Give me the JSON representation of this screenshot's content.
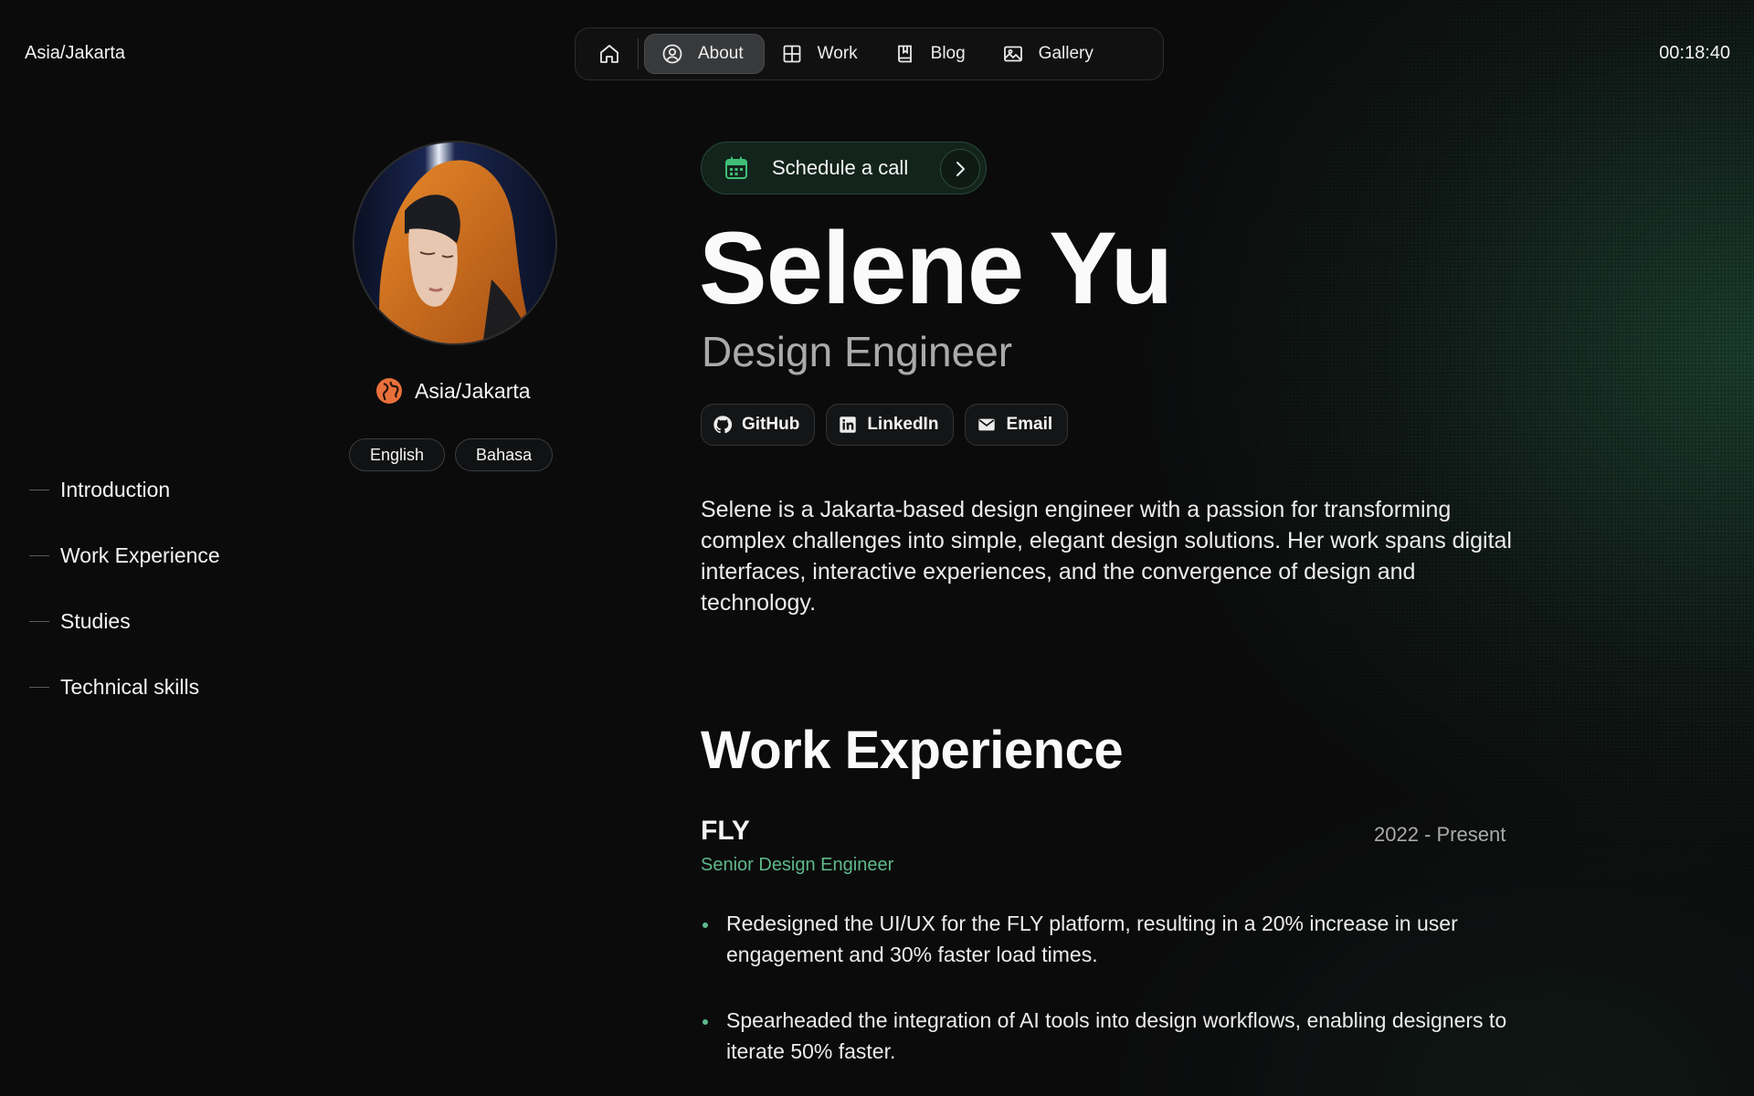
{
  "header": {
    "timezone": "Asia/Jakarta",
    "clock": "00:18:40"
  },
  "nav": {
    "items": [
      {
        "label": "About",
        "icon": "user-circle-icon",
        "active": true
      },
      {
        "label": "Work",
        "icon": "grid-icon"
      },
      {
        "label": "Blog",
        "icon": "book-icon"
      },
      {
        "label": "Gallery",
        "icon": "image-icon"
      }
    ]
  },
  "toc": [
    "Introduction",
    "Work Experience",
    "Studies",
    "Technical skills"
  ],
  "profile": {
    "location": "Asia/Jakarta",
    "languages": [
      "English",
      "Bahasa"
    ]
  },
  "hero": {
    "cta": "Schedule a call",
    "name": "Selene Yu",
    "role": "Design Engineer",
    "socials": [
      "GitHub",
      "LinkedIn",
      "Email"
    ],
    "intro": "Selene is a Jakarta-based design engineer with a passion for transforming complex challenges into simple, elegant design solutions. Her work spans digital interfaces, interactive experiences, and the convergence of design and technology."
  },
  "work": {
    "heading": "Work Experience",
    "jobs": [
      {
        "company": "FLY",
        "period": "2022 - Present",
        "title": "Senior Design Engineer",
        "bullets": [
          "Redesigned the UI/UX for the FLY platform, resulting in a 20% increase in user engagement and 30% faster load times.",
          "Spearheaded the integration of AI tools into design workflows, enabling designers to iterate 50% faster."
        ]
      }
    ]
  },
  "colors": {
    "accent": "#5fb98a",
    "background": "#0b0b0c",
    "globe": "#e8703a"
  }
}
